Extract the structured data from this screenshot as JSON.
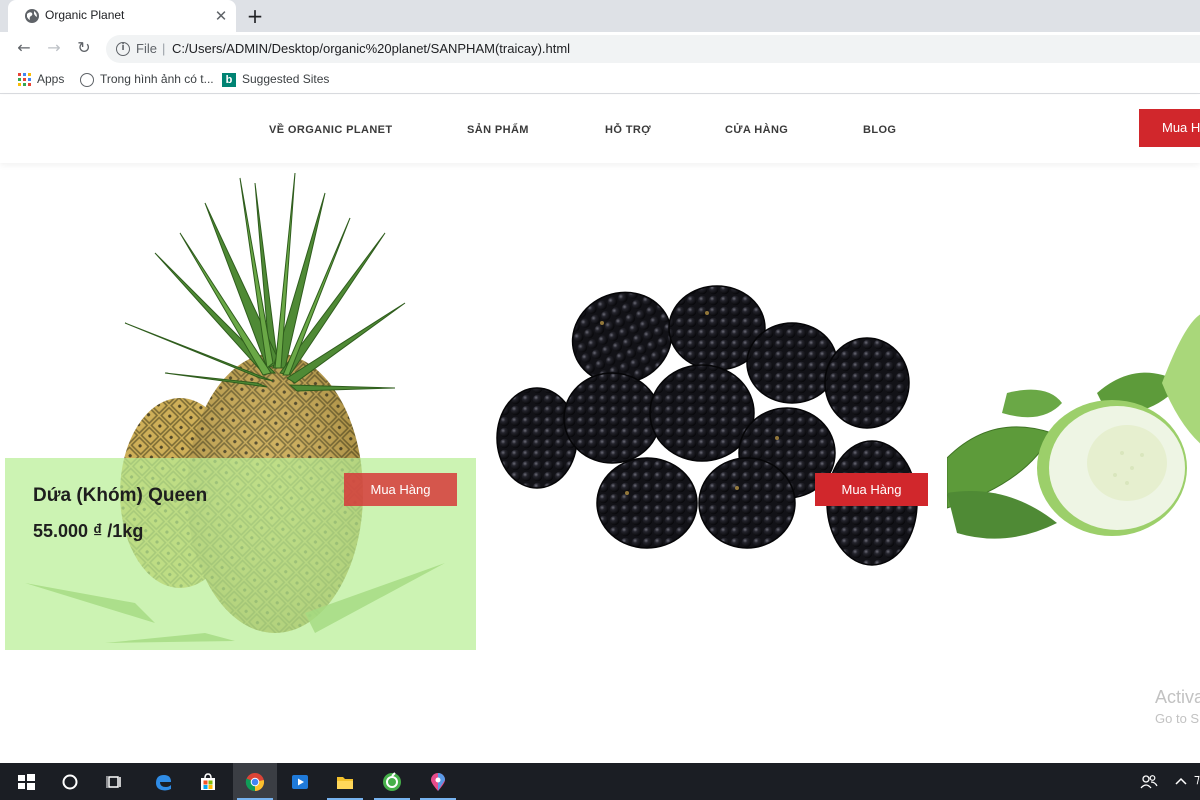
{
  "browser": {
    "tab": {
      "title": "Organic Planet",
      "close": "✕"
    },
    "new_tab": "+",
    "nav": {
      "back": "←",
      "forward": "→",
      "reload": "↻"
    },
    "omnibox": {
      "scheme_label": "File",
      "separator": "|",
      "url": "C:/Users/ADMIN/Desktop/organic%20planet/SANPHAM(traicay).html"
    },
    "bookmarks": [
      {
        "label": "Apps",
        "icon": "apps-grid-icon"
      },
      {
        "label": "Trong hình ảnh có t...",
        "icon": "globe-icon"
      },
      {
        "label": "Suggested Sites",
        "icon": "bing-icon"
      }
    ]
  },
  "site": {
    "nav": [
      {
        "label": "VỀ ORGANIC PLANET"
      },
      {
        "label": "SẢN PHẨM"
      },
      {
        "label": "HỖ TRỢ"
      },
      {
        "label": "CỬA HÀNG"
      },
      {
        "label": "BLOG"
      }
    ],
    "header_cta": "Mua Hàng"
  },
  "products": [
    {
      "image": "pineapple",
      "name": "Dứa (Khóm) Queen",
      "price": "55.000 ₫ /1kg",
      "button": "Mua Hàng"
    },
    {
      "image": "blackberry",
      "button": "Mua Hàng"
    },
    {
      "image": "guava"
    }
  ],
  "watermark": {
    "line1": "Activa",
    "line2": "Go to S"
  },
  "colors": {
    "accent_red": "#d1272c",
    "overlay_green": "#b9ee96",
    "taskbar": "#1b1e24"
  },
  "taskbar": {
    "icons": [
      "windows-start-icon",
      "cortana-search-icon",
      "task-view-icon",
      "edge-icon",
      "store-icon",
      "chrome-icon",
      "media-player-icon",
      "file-explorer-icon",
      "green-app-icon",
      "paint-3d-icon"
    ],
    "tray": [
      "people-icon",
      "chevron-up-icon"
    ]
  }
}
